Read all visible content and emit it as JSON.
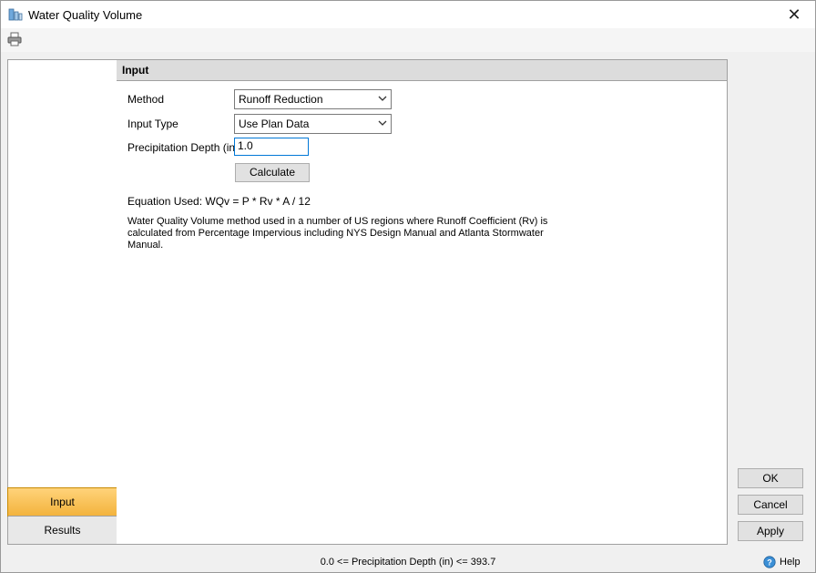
{
  "window": {
    "title": "Water Quality Volume",
    "close_glyph": "✕"
  },
  "toolbar": {
    "print_icon": "print-icon"
  },
  "sidebar": {
    "items": [
      {
        "label": "Input",
        "active": true
      },
      {
        "label": "Results",
        "active": false
      }
    ]
  },
  "panel": {
    "header": "Input",
    "method": {
      "label": "Method",
      "value": "Runoff Reduction"
    },
    "input_type": {
      "label": "Input Type",
      "value": "Use Plan Data"
    },
    "precip": {
      "label": "Precipitation Depth (in)",
      "value": "1.0"
    },
    "calculate_label": "Calculate",
    "equation": "Equation Used: WQv = P * Rv * A / 12",
    "description": "Water Quality Volume method used in a number of US regions where Runoff Coefficient (Rv) is calculated from Percentage Impervious including NYS Design Manual and Atlanta Stormwater Manual."
  },
  "buttons": {
    "ok": "OK",
    "cancel": "Cancel",
    "apply": "Apply"
  },
  "status_text": "0.0 <= Precipitation Depth (in) <= 393.7",
  "help_label": "Help",
  "colors": {
    "active_tab": "#f3b33d",
    "focus_border": "#0078d7"
  }
}
